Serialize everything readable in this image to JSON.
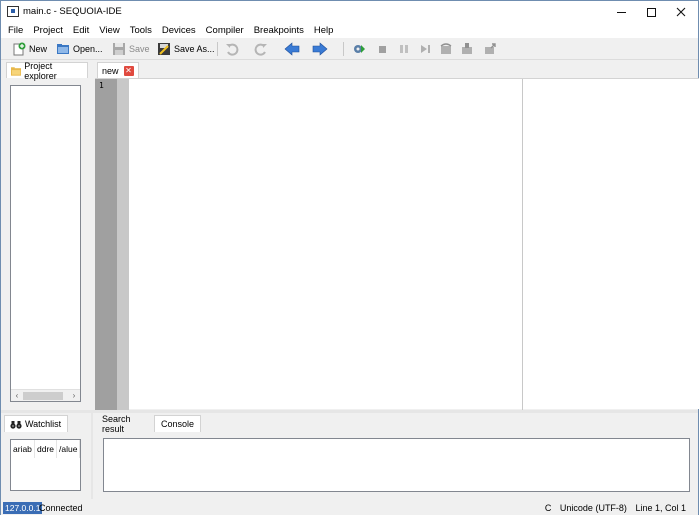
{
  "window": {
    "title": "main.c - SEQUOIA-IDE"
  },
  "menu": [
    "File",
    "Project",
    "Edit",
    "View",
    "Tools",
    "Devices",
    "Compiler",
    "Breakpoints",
    "Help"
  ],
  "toolbar": {
    "new_label": "New",
    "open_label": "Open...",
    "save_label": "Save",
    "save_as_label": "Save As..."
  },
  "left_panel": {
    "tab_label": "Project explorer"
  },
  "editor": {
    "tab_label": "new",
    "line_numbers": [
      "1"
    ]
  },
  "watchlist": {
    "tab_label": "Watchlist",
    "columns": [
      "ariab",
      "ddre",
      "/alue"
    ]
  },
  "bottom_tabs": {
    "search_label": "Search result",
    "console_label": "Console",
    "active": "Console"
  },
  "status": {
    "ip": "127.0.0.1",
    "connection": "Connected",
    "c": "C",
    "encoding": "Unicode (UTF-8)",
    "position": "Line 1, Col 1"
  },
  "colors": {
    "status_ip_bg": "#3a6db5",
    "gutter": "#a0a0a0",
    "tab_close": "#e04a3f"
  }
}
